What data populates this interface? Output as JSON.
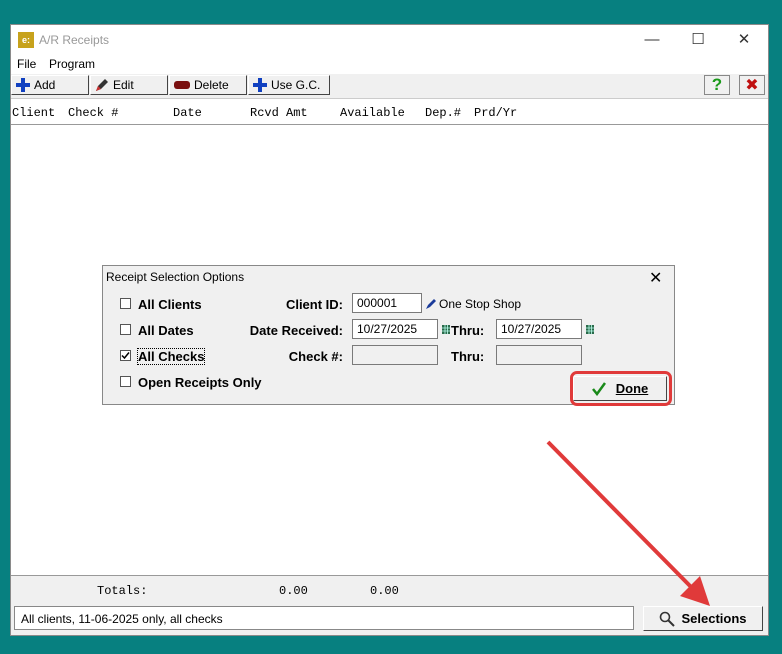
{
  "window": {
    "title": "A/R Receipts"
  },
  "menu": [
    {
      "label": "File"
    },
    {
      "label": "Program"
    }
  ],
  "toolbar": {
    "add_label": "Add",
    "edit_label": "Edit",
    "delete_label": "Delete",
    "use_gc_label": "Use G.C.",
    "help_glyph": "?",
    "close_glyph": "✖"
  },
  "columns": [
    {
      "label": "Client"
    },
    {
      "label": "Check #"
    },
    {
      "label": "Date"
    },
    {
      "label": "Rcvd Amt"
    },
    {
      "label": "Available"
    },
    {
      "label": "Dep.#"
    },
    {
      "label": "Prd/Yr"
    }
  ],
  "rows": [],
  "totals": {
    "label": "Totals:",
    "rcvd_amt": "0.00",
    "available": "0.00"
  },
  "status": {
    "text": "All clients, 11-06-2025 only, all checks"
  },
  "selections_button": {
    "label": "Selections"
  },
  "dialog": {
    "title": "Receipt Selection Options",
    "close_glyph": "✕",
    "options": [
      {
        "label": "All Clients",
        "checked": false
      },
      {
        "label": "All Dates",
        "checked": false
      },
      {
        "label": "All Checks",
        "checked": true
      },
      {
        "label": "Open Receipts Only",
        "checked": false
      }
    ],
    "client_id": {
      "label": "Client ID:",
      "value": "000001",
      "client_name": "One Stop Shop"
    },
    "date_received": {
      "label": "Date Received:",
      "from": "10/27/2025",
      "thru_label": "Thru:",
      "thru": "10/27/2025"
    },
    "check_no": {
      "label": "Check #:",
      "from": "",
      "thru_label": "Thru:",
      "thru": ""
    },
    "done_label": "Done"
  },
  "colors": {
    "highlight": "#e03a3a",
    "background": "#078080"
  }
}
